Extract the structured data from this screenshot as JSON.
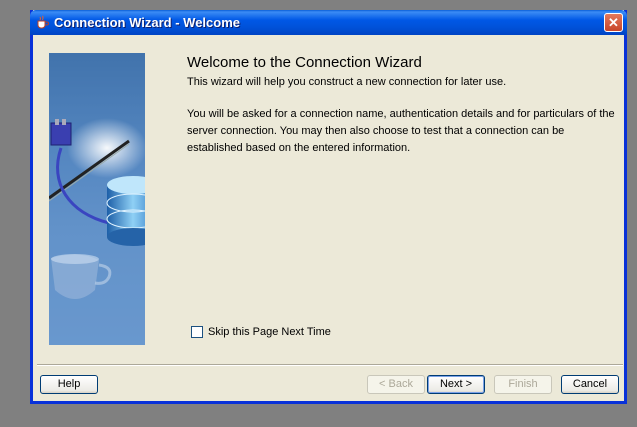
{
  "window": {
    "title": "Connection Wizard - Welcome",
    "close_symbol": "✕"
  },
  "content": {
    "heading": "Welcome to the Connection Wizard",
    "intro": "This wizard will help you construct a new connection for later use.",
    "details": "You will be asked for a connection name, authentication details and for particulars of the server connection. You may then also choose to test that a connection can be established based on the entered information."
  },
  "options": {
    "skip_label": "Skip this Page Next Time",
    "skip_checked": false
  },
  "buttons": {
    "help": "Help",
    "back": "< Back",
    "next": "Next >",
    "finish": "Finish",
    "cancel": "Cancel"
  },
  "icons": {
    "title": "java-cup-icon",
    "close": "close-icon",
    "wizard_graphic": "database-connection-illustration"
  },
  "colors": {
    "titlebar": "#0054e3",
    "dialog_bg": "#ece9d8",
    "close_button": "#d9583b",
    "graphic_panel": "#5b8cc6"
  }
}
